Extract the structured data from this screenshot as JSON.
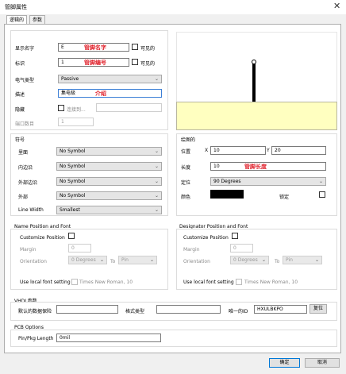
{
  "window": {
    "title": "管脚属性",
    "close_glyph": "✕"
  },
  "tabs": [
    {
      "label": "逻辑的"
    },
    {
      "label": "参数"
    }
  ],
  "logical": {
    "display_name": {
      "label": "显示名字",
      "value": "E",
      "annotation": "管脚名字",
      "visible_label": "可见的"
    },
    "designator": {
      "label": "标识",
      "value": "1",
      "annotation": "管脚编号",
      "visible_label": "可见的"
    },
    "electrical_type": {
      "label": "电气类型",
      "value": "Passive"
    },
    "description": {
      "label": "描述",
      "value": "集电极",
      "annotation": "介绍"
    },
    "hidden": {
      "label": "隐藏",
      "connect_to_label": "连接到...",
      "connect_to_value": ""
    },
    "port_number": {
      "label": "端口数目",
      "value": "1"
    }
  },
  "symbols": {
    "title": "符号",
    "inside": {
      "label": "里面",
      "value": "No Symbol"
    },
    "inside_edge": {
      "label": "内边沿",
      "value": "No Symbol"
    },
    "outside_edge": {
      "label": "外部边沿",
      "value": "No Symbol"
    },
    "outside": {
      "label": "外部",
      "value": "No Symbol"
    },
    "line_width": {
      "label": "Line Width",
      "value": "Smallest"
    }
  },
  "graphical": {
    "title": "绘图的",
    "location_label": "位置",
    "x_label": "X",
    "x_value": "10",
    "y_label": "Y",
    "y_value": "20",
    "length": {
      "label": "长度",
      "value": "10",
      "annotation": "管脚长度"
    },
    "orientation": {
      "label": "定位",
      "value": "90 Degrees"
    },
    "color_label": "颜色",
    "color_value": "#000000",
    "locked_label": "锁定"
  },
  "name_font": {
    "title": "Name Position and Font",
    "customize_label": "Customize Position",
    "margin_label": "Margin",
    "margin_value": "0",
    "orientation_label": "Orientation",
    "orientation_value": "0 Degrees",
    "to_label": "To",
    "to_value": "Pin",
    "local_font_label": "Use local font setting",
    "font_value": "Times New Roman, 10"
  },
  "designator_font": {
    "title": "Designator Position and Font",
    "customize_label": "Customize Position",
    "margin_label": "Margin",
    "margin_value": "0",
    "orientation_label": "Orientation",
    "orientation_value": "0 Degrees",
    "to_label": "To",
    "to_value": "Pin",
    "local_font_label": "Use local font setting",
    "font_value": "Times New Roman, 10"
  },
  "vhdl": {
    "title": "VHDL参数",
    "default_value_label": "默认的数据保险",
    "default_value": "",
    "format_type_label": "格式类型",
    "format_type_value": "",
    "unique_id_label": "唯一的ID",
    "unique_id_value": "HXULBKPO",
    "reset_label": "复位"
  },
  "pcb": {
    "title": "PCB Options",
    "pin_pkg_length_label": "Pin/Pkg Length",
    "pin_pkg_length_value": "0mil"
  },
  "footer": {
    "ok_label": "确定",
    "cancel_label": "取消"
  },
  "colors": {
    "preview_fill": "#ffffc0",
    "accent": "#0078d7",
    "annotation_red": "#e0202a"
  },
  "icons": {
    "dropdown": "chevron-down-icon"
  }
}
